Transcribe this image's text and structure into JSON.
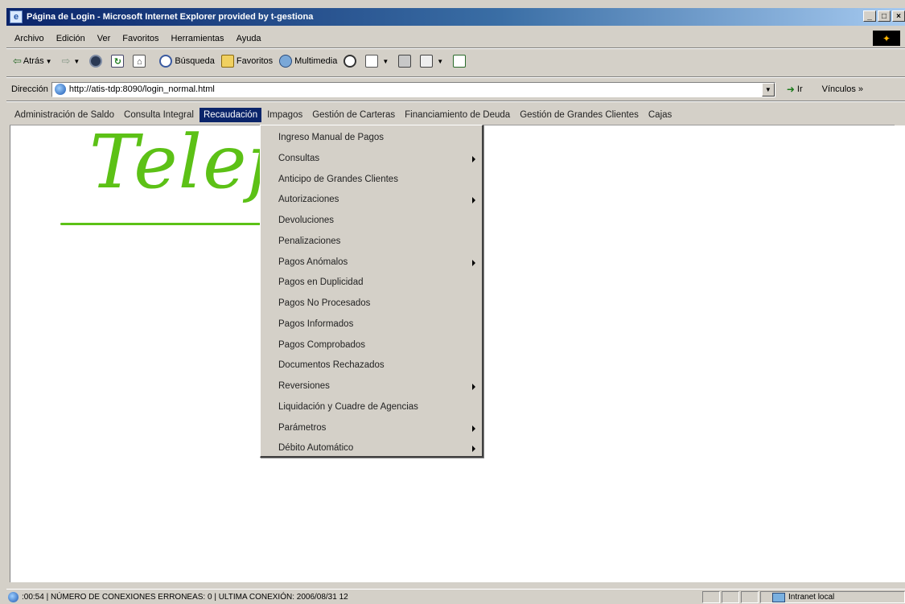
{
  "window": {
    "title": "Página de Login - Microsoft Internet Explorer provided by t-gestiona",
    "minimize": "_",
    "maximize": "□",
    "close": "×"
  },
  "menubar": {
    "items": [
      "Archivo",
      "Edición",
      "Ver",
      "Favoritos",
      "Herramientas",
      "Ayuda"
    ]
  },
  "toolbar": {
    "back": "Atrás",
    "search": "Búsqueda",
    "favorites": "Favoritos",
    "media": "Multimedia"
  },
  "address": {
    "label": "Dirección",
    "url": "http://atis-tdp:8090/login_normal.html",
    "go": "Ir",
    "links": "Vínculos »"
  },
  "appnav": {
    "items": [
      "Administración de Saldo",
      "Consulta Integral",
      "Recaudación",
      "Impagos",
      "Gestión de Carteras",
      "Financiamiento de Deuda",
      "Gestión de Grandes Clientes",
      "Cajas"
    ],
    "active_index": 2
  },
  "logo": {
    "text": "Telefónica"
  },
  "dropdown": {
    "items": [
      {
        "label": "Ingreso Manual de Pagos",
        "submenu": false
      },
      {
        "label": "Consultas",
        "submenu": true
      },
      {
        "label": "Anticipo de Grandes Clientes",
        "submenu": false
      },
      {
        "label": "Autorizaciones",
        "submenu": true
      },
      {
        "label": "Devoluciones",
        "submenu": false
      },
      {
        "label": "Penalizaciones",
        "submenu": false
      },
      {
        "label": "Pagos Anómalos",
        "submenu": true
      },
      {
        "label": "Pagos en Duplicidad",
        "submenu": false
      },
      {
        "label": "Pagos No Procesados",
        "submenu": false
      },
      {
        "label": "Pagos Informados",
        "submenu": false
      },
      {
        "label": "Pagos Comprobados",
        "submenu": false
      },
      {
        "label": "Documentos Rechazados",
        "submenu": false
      },
      {
        "label": "Reversiones",
        "submenu": true
      },
      {
        "label": "Liquidación y Cuadre de Agencias",
        "submenu": false
      },
      {
        "label": "Parámetros",
        "submenu": true
      },
      {
        "label": "Débito Automático",
        "submenu": true
      }
    ]
  },
  "statusbar": {
    "text": ":00:54 | NÚMERO DE CONEXIONES ERRONEAS: 0 | ULTIMA CONEXIÓN: 2006/08/31 12",
    "zone": "Intranet local"
  },
  "colors": {
    "menu_highlight": "#0a246a",
    "logo_green": "#5cc116",
    "titlebar_start": "#0a246a"
  }
}
